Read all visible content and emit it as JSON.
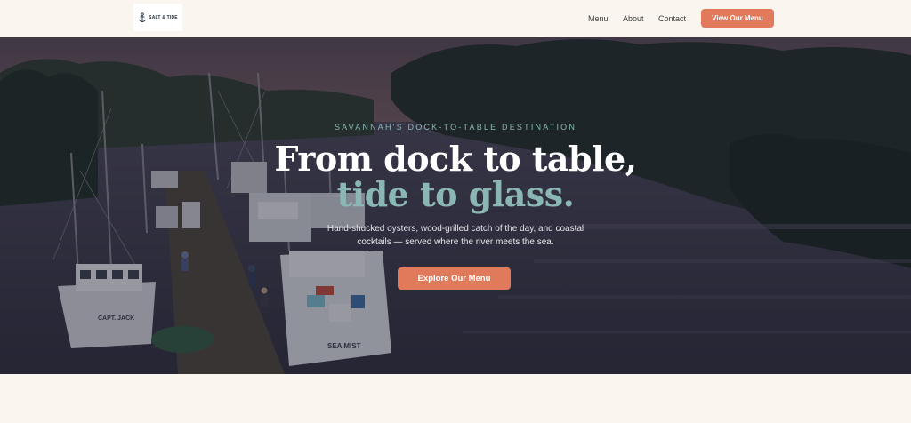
{
  "header": {
    "logo_text": "SALT & TIDE",
    "logo_icon": "anchor-icon",
    "nav": [
      {
        "label": "Menu"
      },
      {
        "label": "About"
      },
      {
        "label": "Contact"
      }
    ],
    "cta_label": "View Our Menu"
  },
  "hero": {
    "eyebrow": "SAVANNAH'S DOCK-TO-TABLE DESTINATION",
    "headline_line1": "From dock to table,",
    "headline_line2": "tide to glass.",
    "subtext": "Hand-shucked oysters, wood-grilled catch of the day, and coastal cocktails — served where the river meets the sea.",
    "button_label": "Explore Our Menu",
    "boat_names": [
      "CAPT. JACK",
      "SEA MIST"
    ]
  },
  "colors": {
    "accent": "#e07a5a",
    "teal": "#8ab7b3",
    "cream": "#faf6ef",
    "navy": "#1e2f44"
  }
}
